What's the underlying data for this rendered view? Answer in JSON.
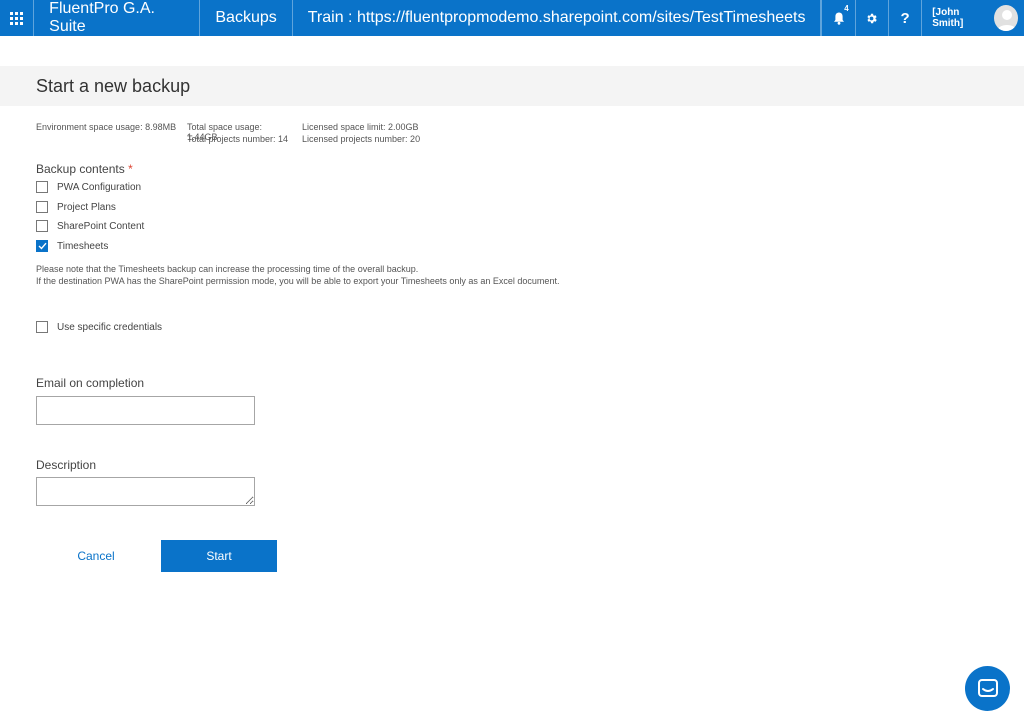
{
  "header": {
    "suite_name": "FluentPro G.A. Suite",
    "app_name": "Backups",
    "site_label": "Train : https://fluentpropmodemo.sharepoint.com/sites/TestTimesheets",
    "notification_count": "4",
    "user_name": "[John Smith]",
    "accent_color": "#0a73c9"
  },
  "page": {
    "title": "Start a new backup"
  },
  "stats": {
    "env_space": "Environment space usage: 8.98MB",
    "total_space": "Total space usage: 1.44GB",
    "licensed_space": "Licensed space limit: 2.00GB",
    "total_projects": "Total projects number: 14",
    "licensed_projects": "Licensed projects number: 20"
  },
  "backup_contents": {
    "label": "Backup contents",
    "required_mark": "*",
    "options": [
      {
        "label": "PWA Configuration",
        "checked": false
      },
      {
        "label": "Project Plans",
        "checked": false
      },
      {
        "label": "SharePoint Content",
        "checked": false
      },
      {
        "label": "Timesheets",
        "checked": true
      }
    ],
    "note_line1": "Please note that the Timesheets backup can increase the processing time of the overall backup.",
    "note_line2": "If the destination PWA has the SharePoint permission mode, you will be able to export your Timesheets only as an Excel document."
  },
  "credentials": {
    "label": "Use specific credentials",
    "checked": false
  },
  "email": {
    "label": "Email on completion",
    "value": "",
    "placeholder": ""
  },
  "description": {
    "label": "Description",
    "value": "",
    "placeholder": ""
  },
  "actions": {
    "cancel_label": "Cancel",
    "start_label": "Start"
  },
  "icons": {
    "app_launcher": "waffle-icon",
    "notifications": "bell-icon",
    "settings": "gear-icon",
    "help": "question-icon",
    "user": "avatar-icon",
    "chat": "chat-icon",
    "check": "check-icon"
  }
}
